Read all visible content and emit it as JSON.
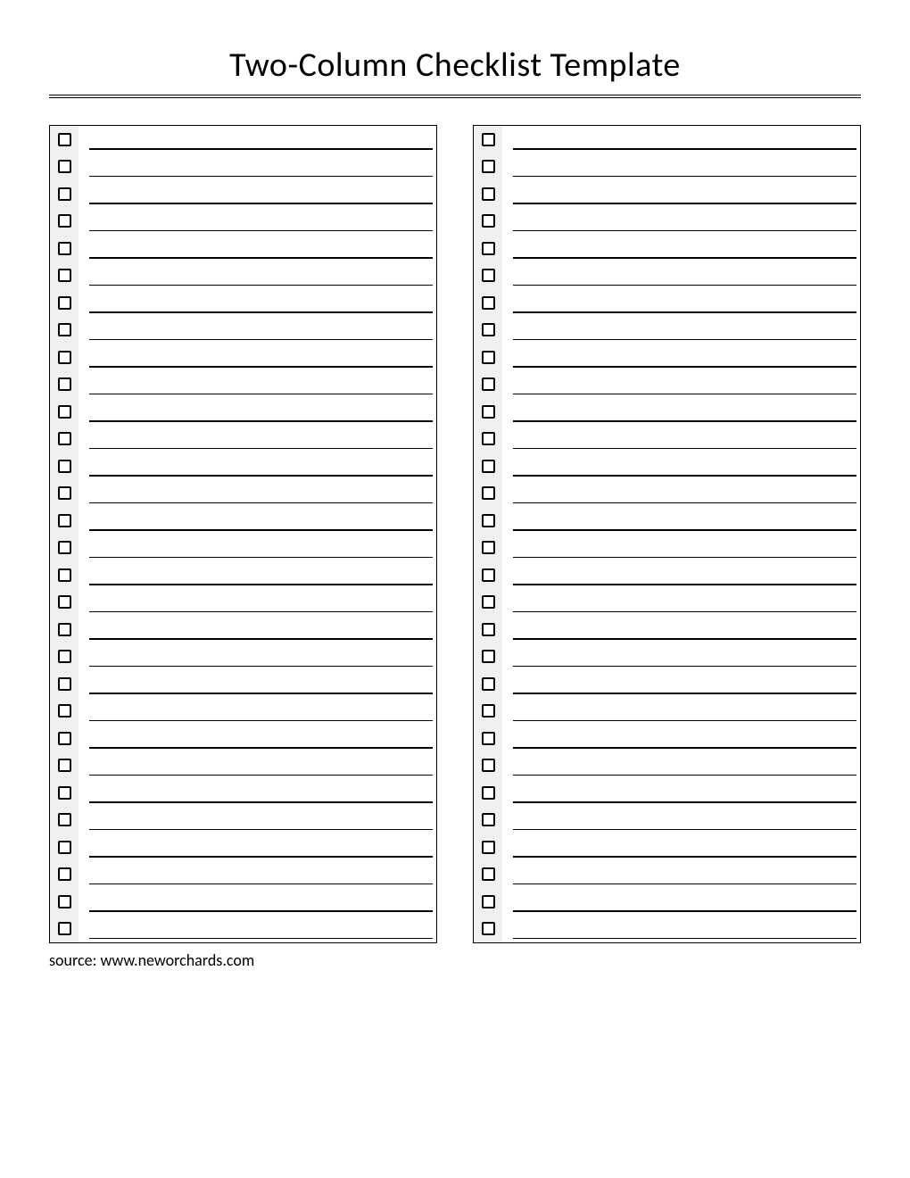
{
  "title": "Two-Column Checklist Template",
  "source_text": "source: www.neworchards.com",
  "rows_per_column": 30,
  "columns": 2
}
